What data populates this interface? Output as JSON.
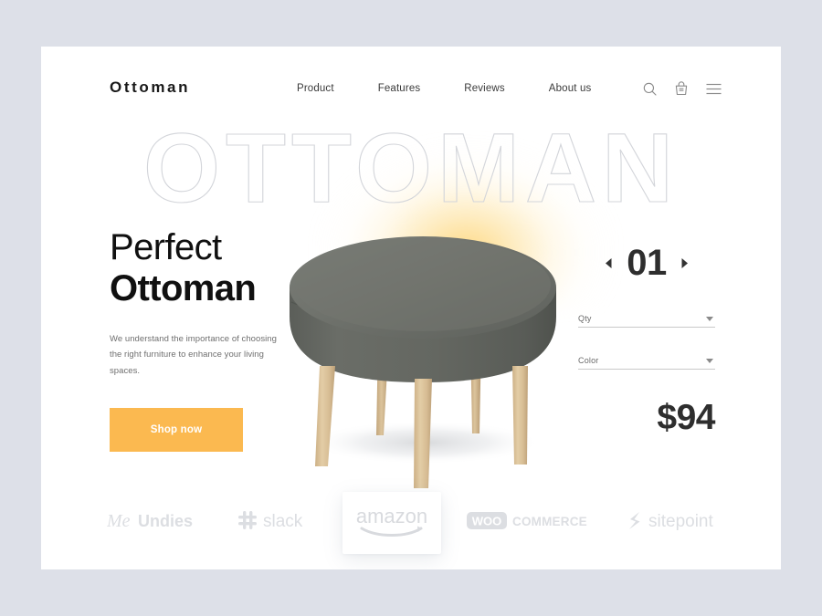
{
  "page": {
    "background_color": "#dde0e8",
    "card_background": "#ffffff"
  },
  "header": {
    "logo": "Ottoman",
    "nav": [
      {
        "label": "Product"
      },
      {
        "label": "Features"
      },
      {
        "label": "Reviews"
      },
      {
        "label": "About us"
      }
    ],
    "icons": [
      {
        "name": "search-icon"
      },
      {
        "name": "cart-icon"
      },
      {
        "name": "menu-icon"
      }
    ]
  },
  "watermark": {
    "text": "OTTOMAN",
    "stroke_color": "#d3d5da",
    "glow_color": "#fcc23a"
  },
  "hero": {
    "title_line1": "Perfect",
    "title_line2": "Ottoman",
    "description": "We understand the importance of choosing the right furniture to enhance your living spaces.",
    "cta_label": "Shop now",
    "cta_color": "#fbb950"
  },
  "product": {
    "alt": "Gray round ottoman with four tapered wooden legs",
    "fabric_color": "#6a6d68",
    "leg_color": "#d8bd94"
  },
  "purchase": {
    "slide_number": "01",
    "prev_label": "Previous",
    "next_label": "Next",
    "fields": [
      {
        "label": "Qty",
        "value": ""
      },
      {
        "label": "Color",
        "value": ""
      }
    ],
    "price": "$94"
  },
  "brands": [
    {
      "name": "MeUndies",
      "text_a": "Me",
      "text_b": "Undies"
    },
    {
      "name": "slack",
      "text_a": "",
      "text_b": "slack"
    },
    {
      "name": "amazon",
      "text_a": "",
      "text_b": "amazon"
    },
    {
      "name": "WooCommerce",
      "text_a": "WOO",
      "text_b": "COMMERCE"
    },
    {
      "name": "sitepoint",
      "text_a": "",
      "text_b": "sitepoint"
    }
  ]
}
